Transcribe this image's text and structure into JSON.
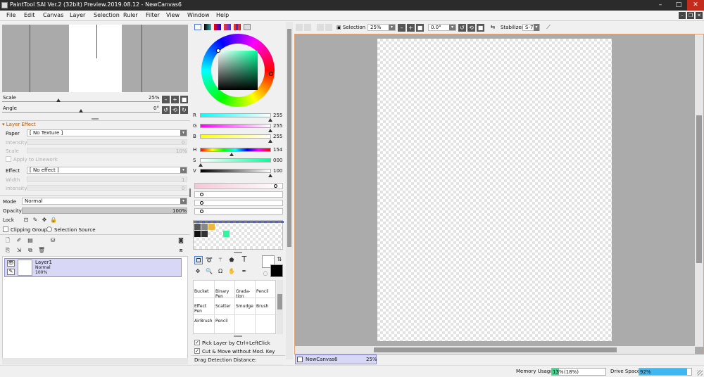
{
  "window": {
    "title": "PaintTool SAI Ver.2 (32bit) Preview.2019.08.12 - NewCanvas6"
  },
  "menu": [
    "File",
    "Edit",
    "Canvas",
    "Layer",
    "Selection",
    "Ruler",
    "Filter",
    "View",
    "Window",
    "Help"
  ],
  "navigator": {
    "scale_label": "Scale",
    "scale_value": "25%",
    "angle_label": "Angle",
    "angle_value": "0°"
  },
  "layer_effect": {
    "header": "Layer Effect",
    "paper_label": "Paper",
    "paper_value": "[ No Texture ]",
    "intensity_label": "Intensity",
    "intensity_value": "0",
    "scale_label": "Scale",
    "scale_value": "10%",
    "apply_linework": "Apply to Linework",
    "effect_label": "Effect",
    "effect_value": "[ No effect ]",
    "width_label": "Width",
    "width_value": "1",
    "intensity2_label": "Intensity",
    "intensity2_value": "0"
  },
  "layer_props": {
    "mode_label": "Mode",
    "mode_value": "Normal",
    "opacity_label": "Opacity",
    "opacity_value": "100%",
    "lock_label": "Lock",
    "clipping_group": "Clipping Group",
    "selection_source": "Selection Source"
  },
  "layers": [
    {
      "name": "Layer1",
      "mode": "Normal",
      "opacity": "100%"
    }
  ],
  "color": {
    "R": "255",
    "G": "255",
    "B": "255",
    "H": "154",
    "S": "000",
    "V": "100",
    "r_label": "R",
    "g_label": "G",
    "b_label": "B",
    "h_label": "H",
    "s_label": "S",
    "v_label": "V",
    "accent": "#ffffff"
  },
  "tools": {
    "text_tool": "T",
    "brushes": [
      {
        "name": "Bucket"
      },
      {
        "name": "Binary Pen"
      },
      {
        "name": "Grada-tion"
      },
      {
        "name": "Pencil"
      },
      {
        "name": "Effect Pen"
      },
      {
        "name": "Scatter"
      },
      {
        "name": "Smudge"
      },
      {
        "name": "Brush"
      },
      {
        "name": "AirBrush"
      },
      {
        "name": "Pencil"
      }
    ],
    "pick_layer": "Pick Layer by Ctrl+LeftClick",
    "cut_move": "Cut & Move without Mod. Key",
    "drag_detection": "Drag Detection Distance:"
  },
  "toolbar": {
    "selection_label": "Selection",
    "zoom_value": "25%",
    "angle_value": "0.0°",
    "stabilizer_label": "Stabilizer",
    "stabilizer_value": "S-7"
  },
  "canvas_tab": {
    "name": "NewCanvas6",
    "zoom": "25%"
  },
  "status": {
    "memory_label": "Memory Usage",
    "memory_value": "13%",
    "memory_extra": "(18%)",
    "memory_fraction": 0.13,
    "drive_label": "Drive Space",
    "drive_value": "92%",
    "drive_fraction": 0.92
  }
}
